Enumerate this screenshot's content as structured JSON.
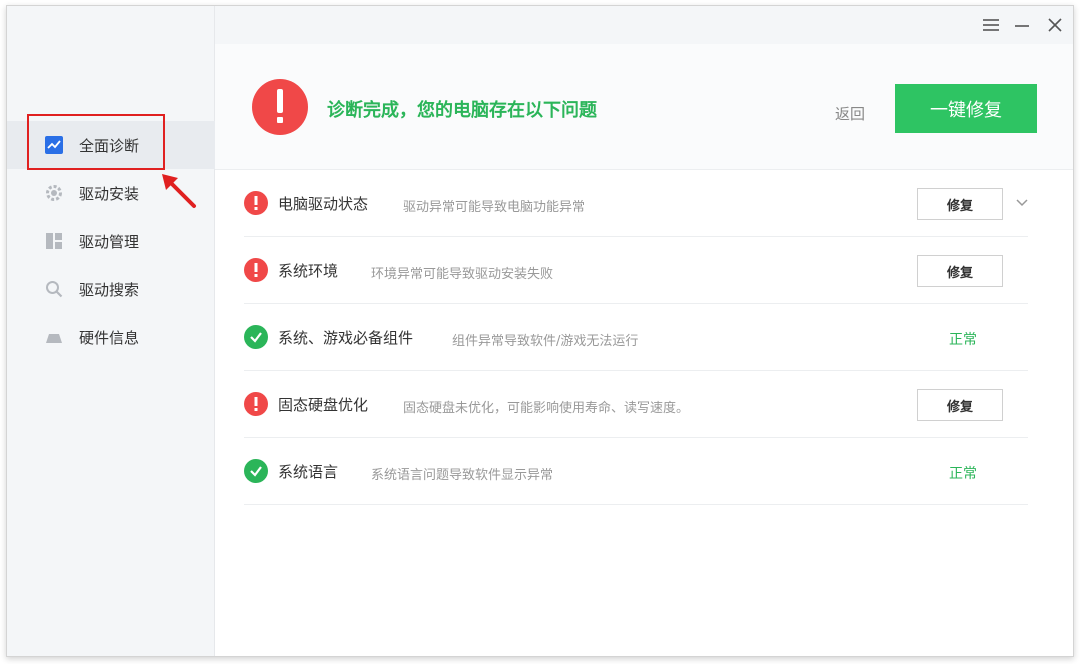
{
  "sidebar": {
    "items": [
      {
        "label": "全面诊断",
        "icon": "chart-icon",
        "active": true
      },
      {
        "label": "驱动安装",
        "icon": "gear-icon",
        "active": false
      },
      {
        "label": "驱动管理",
        "icon": "grid-icon",
        "active": false
      },
      {
        "label": "驱动搜索",
        "icon": "search-icon",
        "active": false
      },
      {
        "label": "硬件信息",
        "icon": "hardware-icon",
        "active": false
      }
    ]
  },
  "header": {
    "title": "诊断完成，您的电脑存在以下问题",
    "back_label": "返回",
    "fix_all_label": "一键修复"
  },
  "rows": [
    {
      "title": "电脑驱动状态",
      "desc": "驱动异常可能导致电脑功能异常",
      "status": "error",
      "action": "修复"
    },
    {
      "title": "系统环境",
      "desc": "环境异常可能导致驱动安装失败",
      "status": "error",
      "action": "修复"
    },
    {
      "title": "系统、游戏必备组件",
      "desc": "组件异常导致软件/游戏无法运行",
      "status": "ok",
      "ok_label": "正常"
    },
    {
      "title": "固态硬盘优化",
      "desc": "固态硬盘未优化，可能影响使用寿命、读写速度。",
      "status": "error",
      "action": "修复"
    },
    {
      "title": "系统语言",
      "desc": "系统语言问题导致软件显示异常",
      "status": "ok",
      "ok_label": "正常"
    }
  ],
  "colors": {
    "accent_green": "#2ec463",
    "ok_green": "#2bb559",
    "error_red": "#f04848",
    "highlight_red": "#e02020"
  }
}
